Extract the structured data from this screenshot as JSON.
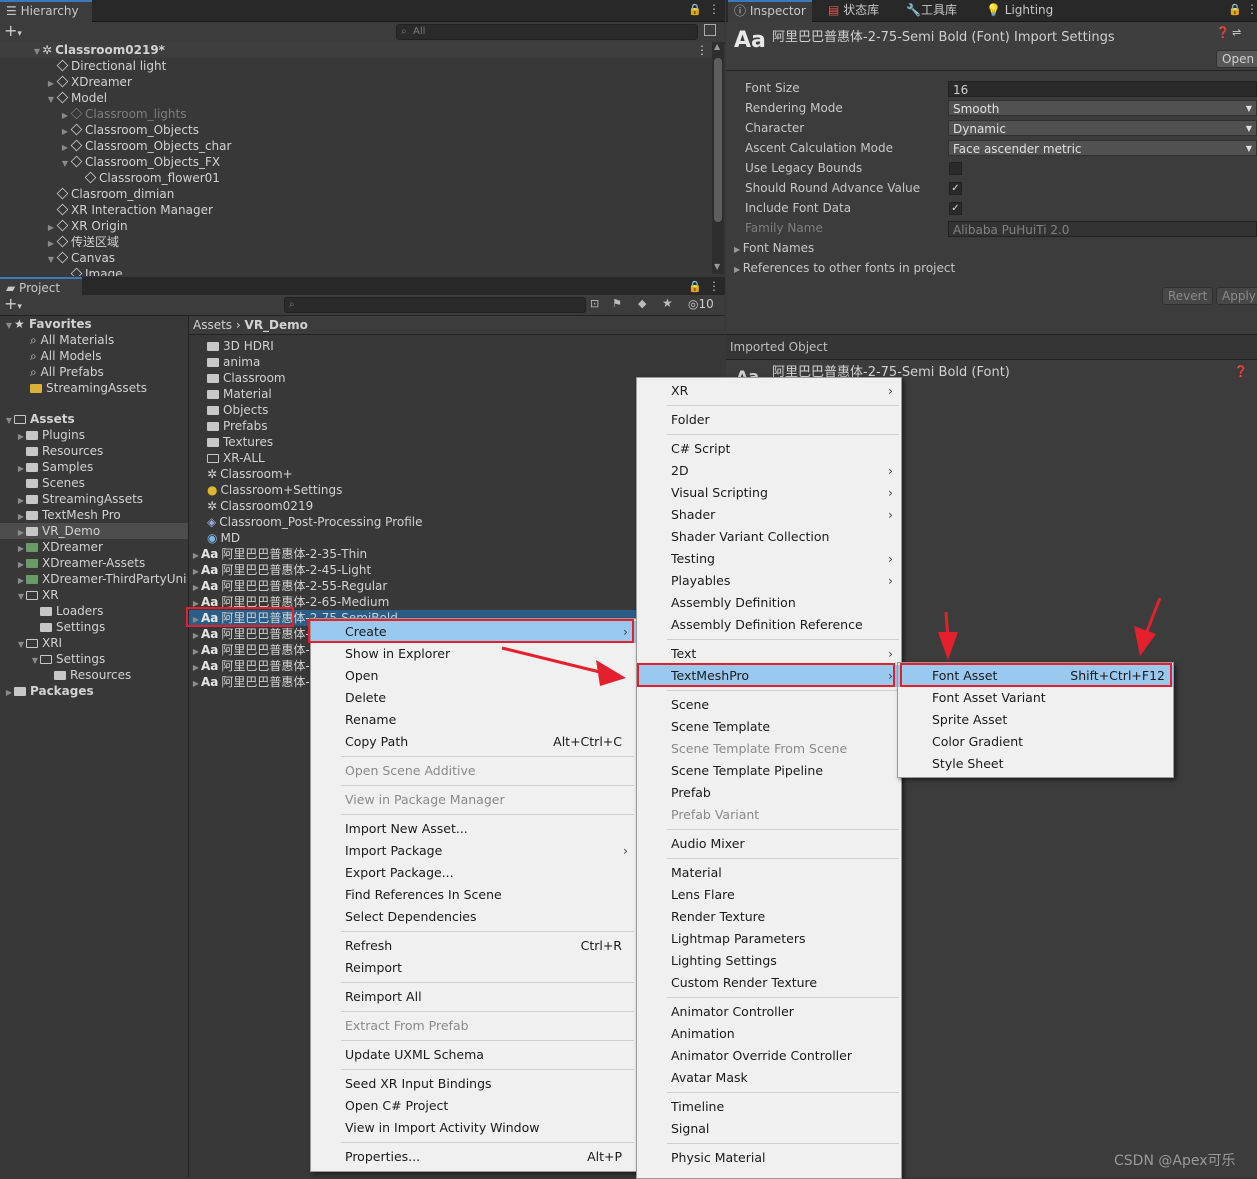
{
  "hierarchy": {
    "tab_label": "Hierarchy",
    "search_placeholder": "All",
    "scene_name": "Classroom0219*",
    "items": [
      {
        "label": "Directional light"
      },
      {
        "label": "XDreamer"
      },
      {
        "label": "Model"
      },
      {
        "label": "Classroom_lights"
      },
      {
        "label": "Classroom_Objects"
      },
      {
        "label": "Classroom_Objects_char"
      },
      {
        "label": "Classroom_Objects_FX"
      },
      {
        "label": "Classroom_flower01"
      },
      {
        "label": "Clasroom_dimian"
      },
      {
        "label": "XR Interaction Manager"
      },
      {
        "label": "XR Origin"
      },
      {
        "label": "传送区域"
      },
      {
        "label": "Canvas"
      },
      {
        "label": "Image"
      }
    ]
  },
  "project": {
    "tab_label": "Project",
    "hidden_count": "10",
    "breadcrumb": {
      "root": "Assets",
      "separator": "›",
      "current": "VR_Demo"
    },
    "favorites_label": "Favorites",
    "favorites": [
      "All Materials",
      "All Models",
      "All Prefabs",
      "StreamingAssets"
    ],
    "assets_label": "Assets",
    "tree": [
      "Plugins",
      "Resources",
      "Samples",
      "Scenes",
      "StreamingAssets",
      "TextMesh Pro",
      "VR_Demo",
      "XDreamer",
      "XDreamer-Assets",
      "XDreamer-ThirdPartyUni",
      "XR",
      "Loaders",
      "Settings",
      "XRI",
      "Settings",
      "Resources"
    ],
    "packages_label": "Packages",
    "files": [
      "3D HDRI",
      "anima",
      "Classroom",
      "Material",
      "Objects",
      "Prefabs",
      "Textures",
      "XR-ALL",
      "Classroom+",
      "Classroom+Settings",
      "Classroom0219",
      "Classroom_Post-Processing Profile",
      "MD",
      "阿里巴巴普惠体-2-35-Thin",
      "阿里巴巴普惠体-2-45-Light",
      "阿里巴巴普惠体-2-55-Regular",
      "阿里巴巴普惠体-2-65-Medium",
      "阿里巴巴普惠体-2-75-SemiBold",
      "阿里巴巴普惠体-",
      "阿里巴巴普惠体-",
      "阿里巴巴普惠体-",
      "阿里巴巴普惠体-"
    ]
  },
  "inspector": {
    "tabs": [
      "Inspector",
      "状态库",
      "工具库",
      "Lighting"
    ],
    "header_icon": "Aa",
    "title": "阿里巴巴普惠体-2-75-Semi Bold (Font) Import Settings",
    "open_button": "Open",
    "props": [
      {
        "label": "Font Size",
        "value": "16"
      },
      {
        "label": "Rendering Mode",
        "value": "Smooth"
      },
      {
        "label": "Character",
        "value": "Dynamic"
      },
      {
        "label": "Ascent Calculation Mode",
        "value": "Face ascender metric"
      },
      {
        "label": "Use Legacy Bounds",
        "value": ""
      },
      {
        "label": "Should Round Advance Value",
        "value": "✓"
      },
      {
        "label": "Include Font Data",
        "value": "✓"
      },
      {
        "label": "Family Name",
        "value": "Alibaba PuHuiTi 2.0"
      }
    ],
    "font_names": "Font Names",
    "references": "References to other fonts in project",
    "revert": "Revert",
    "apply": "Apply",
    "imported_object": "Imported Object",
    "imported_name": "阿里巴巴普惠体-2-75-Semi Bold (Font)"
  },
  "context_menu": {
    "items": [
      {
        "label": "Create",
        "arrow": "›"
      },
      {
        "label": "Show in Explorer"
      },
      {
        "label": "Open"
      },
      {
        "label": "Delete"
      },
      {
        "label": "Rename"
      },
      {
        "label": "Copy Path",
        "shortcut": "Alt+Ctrl+C"
      },
      {
        "label": "Open Scene Additive"
      },
      {
        "label": "View in Package Manager"
      },
      {
        "label": "Import New Asset..."
      },
      {
        "label": "Import Package",
        "arrow": "›"
      },
      {
        "label": "Export Package..."
      },
      {
        "label": "Find References In Scene"
      },
      {
        "label": "Select Dependencies"
      },
      {
        "label": "Refresh",
        "shortcut": "Ctrl+R"
      },
      {
        "label": "Reimport"
      },
      {
        "label": "Reimport All"
      },
      {
        "label": "Extract From Prefab"
      },
      {
        "label": "Update UXML Schema"
      },
      {
        "label": "Seed XR Input Bindings"
      },
      {
        "label": "Open C# Project"
      },
      {
        "label": "View in Import Activity Window"
      },
      {
        "label": "Properties...",
        "shortcut": "Alt+P"
      }
    ]
  },
  "create_menu": {
    "items": [
      {
        "label": "XR",
        "arrow": "›"
      },
      {
        "label": "Folder"
      },
      {
        "label": "C# Script"
      },
      {
        "label": "2D",
        "arrow": "›"
      },
      {
        "label": "Visual Scripting",
        "arrow": "›"
      },
      {
        "label": "Shader",
        "arrow": "›"
      },
      {
        "label": "Shader Variant Collection"
      },
      {
        "label": "Testing",
        "arrow": "›"
      },
      {
        "label": "Playables",
        "arrow": "›"
      },
      {
        "label": "Assembly Definition"
      },
      {
        "label": "Assembly Definition Reference"
      },
      {
        "label": "Text",
        "arrow": "›"
      },
      {
        "label": "TextMeshPro",
        "arrow": "›"
      },
      {
        "label": "Scene"
      },
      {
        "label": "Scene Template"
      },
      {
        "label": "Scene Template From Scene"
      },
      {
        "label": "Scene Template Pipeline"
      },
      {
        "label": "Prefab"
      },
      {
        "label": "Prefab Variant"
      },
      {
        "label": "Audio Mixer"
      },
      {
        "label": "Material"
      },
      {
        "label": "Lens Flare"
      },
      {
        "label": "Render Texture"
      },
      {
        "label": "Lightmap Parameters"
      },
      {
        "label": "Lighting Settings"
      },
      {
        "label": "Custom Render Texture"
      },
      {
        "label": "Animator Controller"
      },
      {
        "label": "Animation"
      },
      {
        "label": "Animator Override Controller"
      },
      {
        "label": "Avatar Mask"
      },
      {
        "label": "Timeline"
      },
      {
        "label": "Signal"
      },
      {
        "label": "Physic Material"
      }
    ]
  },
  "tmp_menu": {
    "items": [
      {
        "label": "Font Asset",
        "shortcut": "Shift+Ctrl+F12"
      },
      {
        "label": "Font Asset Variant"
      },
      {
        "label": "Sprite Asset"
      },
      {
        "label": "Color Gradient"
      },
      {
        "label": "Style Sheet"
      }
    ]
  },
  "watermark": "CSDN @Apex可乐",
  "colors": {
    "highlight": "#99c9ef",
    "annotation": "#e4202d",
    "selection": "#2c5d87"
  }
}
